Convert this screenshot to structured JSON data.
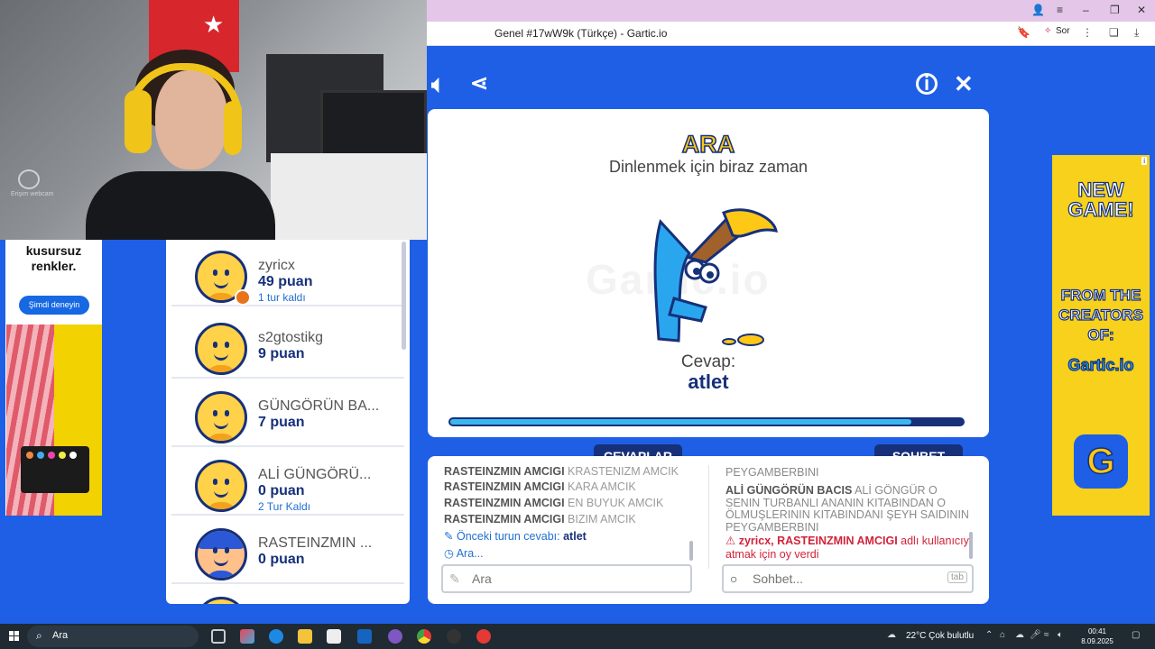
{
  "browser": {
    "tab_title": "Genel #17wW9k (Türkçe) - Gartic.io",
    "sor_label": "Sor"
  },
  "webcam": {
    "label": "Erişim webcam"
  },
  "left_ad": {
    "headline": "kusursuz renkler.",
    "button": "Şimdi deneyin"
  },
  "players": [
    {
      "name": "zyricx",
      "points": "49 puan",
      "info": "1 tur kaldı",
      "avatar": "smiley-yellow"
    },
    {
      "name": "s2gtostikg",
      "points": "9 puan",
      "info": "",
      "avatar": "smiley-yellow"
    },
    {
      "name": "GÜNGÖRÜN BA...",
      "points": "7 puan",
      "info": "",
      "avatar": "smiley-yellow"
    },
    {
      "name": "ALİ GÜNGÖRÜ...",
      "points": "0 puan",
      "info": "2 Tur Kaldı",
      "avatar": "smiley-yellow"
    },
    {
      "name": "RASTEINZMIN ...",
      "points": "0 puan",
      "info": "",
      "avatar": "boy-blue-hair"
    }
  ],
  "game": {
    "state_title": "ARA",
    "state_subtitle": "Dinlenmek için biraz zaman",
    "answer_label": "Cevap:",
    "answer": "atlet",
    "watermark": "Gartic.io",
    "progress": 0.9
  },
  "tabs": {
    "answers": "CEVAPLAR",
    "chat": "SOHBET"
  },
  "answers": [
    {
      "user": "RASTEINZMIN AMCIGI",
      "text": "KRASTENIZM AMCIK"
    },
    {
      "user": "RASTEINZMIN AMCIGI",
      "text": "KARA AMCIK"
    },
    {
      "user": "RASTEINZMIN AMCIGI",
      "text": "EN BUYUK AMCIK"
    },
    {
      "user": "RASTEINZMIN AMCIGI",
      "text": "BIZIM AMCIK"
    }
  ],
  "answer_notes": {
    "prev_label": "Önceki turun cevabı:",
    "prev_value": "atlet",
    "waiting": "Ara..."
  },
  "chat": {
    "fragment": "PEYGAMBERBINI",
    "message_user": "ALİ GÜNGÖRÜN BACIS",
    "message_text": "ALİ GÖNGÜR O SENIN TURBANLI ANANIN KITABINDAN O ÖLMUŞLERININ KITABINDANI ŞEYH SAIDININ PEYGAMBERBINI",
    "warning_prefix": "zyricx,",
    "warning_user": "RASTEINZMIN AMCIGI",
    "warning_text": "adlı kullanıcıyı atmak için oy verdi"
  },
  "inputs": {
    "answer_placeholder": "Ara",
    "chat_placeholder": "Sohbet...",
    "tab_hint": "tab"
  },
  "right_ad": {
    "line1": "NEW GAME!",
    "line2": "FROM THE CREATORS OF:",
    "logo": "Gartic.io",
    "tag": "i",
    "icon_letter": "G"
  },
  "taskbar": {
    "search": "Ara",
    "weather": "22°C  Çok bulutlu",
    "time": "00:41",
    "date": "8.09.2025"
  },
  "colors": {
    "background": "#1e5fe6",
    "navy": "#16307a",
    "yellow": "#ffc816",
    "progress": "#3bb7f0",
    "warning": "#d2233a"
  }
}
